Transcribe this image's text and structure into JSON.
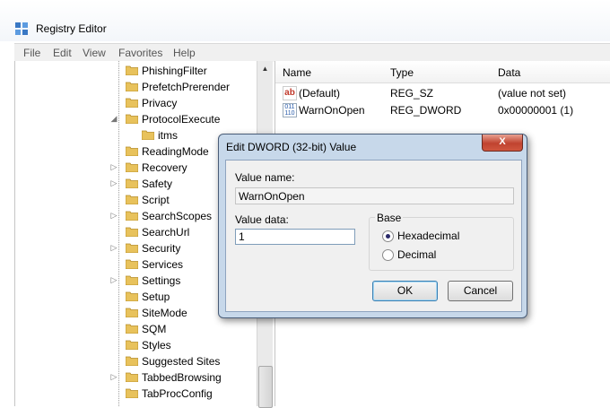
{
  "window": {
    "title": "Registry Editor"
  },
  "menu": [
    "File",
    "Edit",
    "View",
    "Favorites",
    "Help"
  ],
  "tree": {
    "items": [
      {
        "label": "PhishingFilter",
        "expander": ""
      },
      {
        "label": "PrefetchPrerender",
        "expander": ""
      },
      {
        "label": "Privacy",
        "expander": ""
      },
      {
        "label": "ProtocolExecute",
        "expander": "◢"
      },
      {
        "label": "itms",
        "expander": "",
        "child": true
      },
      {
        "label": "ReadingMode",
        "expander": ""
      },
      {
        "label": "Recovery",
        "expander": "▷"
      },
      {
        "label": "Safety",
        "expander": "▷"
      },
      {
        "label": "Script",
        "expander": ""
      },
      {
        "label": "SearchScopes",
        "expander": "▷"
      },
      {
        "label": "SearchUrl",
        "expander": ""
      },
      {
        "label": "Security",
        "expander": "▷"
      },
      {
        "label": "Services",
        "expander": ""
      },
      {
        "label": "Settings",
        "expander": "▷"
      },
      {
        "label": "Setup",
        "expander": ""
      },
      {
        "label": "SiteMode",
        "expander": ""
      },
      {
        "label": "SQM",
        "expander": ""
      },
      {
        "label": "Styles",
        "expander": ""
      },
      {
        "label": "Suggested Sites",
        "expander": ""
      },
      {
        "label": "TabbedBrowsing",
        "expander": "▷"
      },
      {
        "label": "TabProcConfig",
        "expander": ""
      }
    ]
  },
  "list": {
    "columns": [
      "Name",
      "Type",
      "Data"
    ],
    "rows": [
      {
        "name": "(Default)",
        "type": "REG_SZ",
        "data": "(value not set)",
        "icon": "string-value-icon",
        "glyph": "ab"
      },
      {
        "name": "WarnOnOpen",
        "type": "REG_DWORD",
        "data": "0x00000001 (1)",
        "icon": "binary-value-icon",
        "glyph": "011\n110"
      }
    ]
  },
  "dialog": {
    "title": "Edit DWORD (32-bit) Value",
    "close": "X",
    "value_name_label": "Value name:",
    "value_name": "WarnOnOpen",
    "value_data_label": "Value data:",
    "value_data": "1",
    "base_label": "Base",
    "hex_label": "Hexadecimal",
    "dec_label": "Decimal",
    "ok": "OK",
    "cancel": "Cancel"
  },
  "colors": {
    "accent": "#3c7fb1",
    "close": "#c0432f",
    "folder": "#e8c25c"
  }
}
